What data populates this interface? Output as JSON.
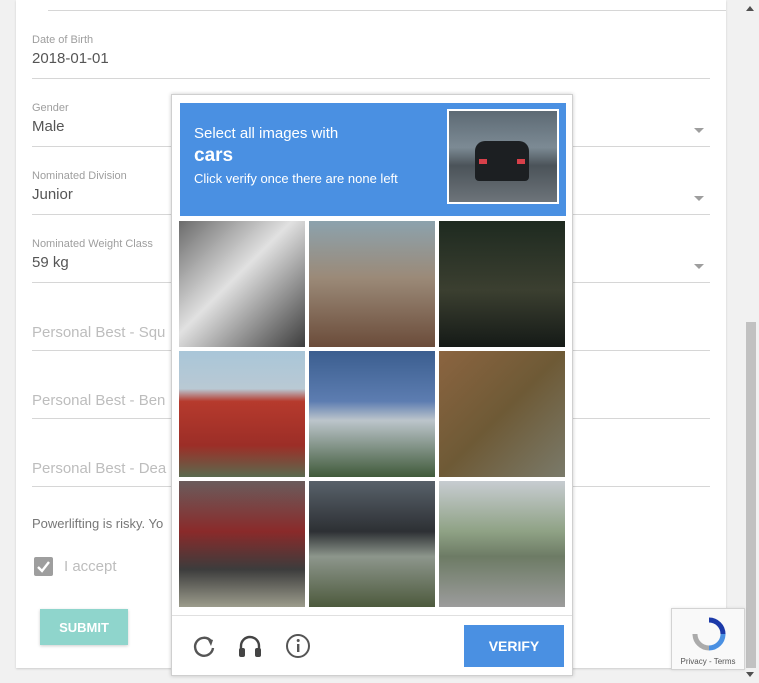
{
  "form": {
    "dob": {
      "label": "Date of Birth",
      "value": "2018-01-01"
    },
    "gender": {
      "label": "Gender",
      "value": "Male"
    },
    "division": {
      "label": "Nominated Division",
      "value": "Junior"
    },
    "weight_class": {
      "label": "Nominated Weight Class",
      "value": "59 kg"
    },
    "pb_squat": {
      "placeholder": "Personal Best - Squ"
    },
    "pb_bench": {
      "placeholder": "Personal Best - Ben"
    },
    "pb_dead": {
      "placeholder": "Personal Best - Dea"
    },
    "disclaimer": "Powerlifting is risky. Yo",
    "accept_label": "I accept",
    "submit_label": "SUBMIT"
  },
  "captcha": {
    "line1": "Select all images with",
    "keyword": "cars",
    "line3": "Click verify once there are none left",
    "verify_label": "VERIFY",
    "footer_icons": [
      "reload-icon",
      "headphones-icon",
      "info-icon"
    ]
  },
  "recaptcha_badge": {
    "links": "Privacy - Terms"
  },
  "colors": {
    "accent": "#4a90e2",
    "submit": "#8fd5cc",
    "checkbox": "#9e9e9e"
  }
}
